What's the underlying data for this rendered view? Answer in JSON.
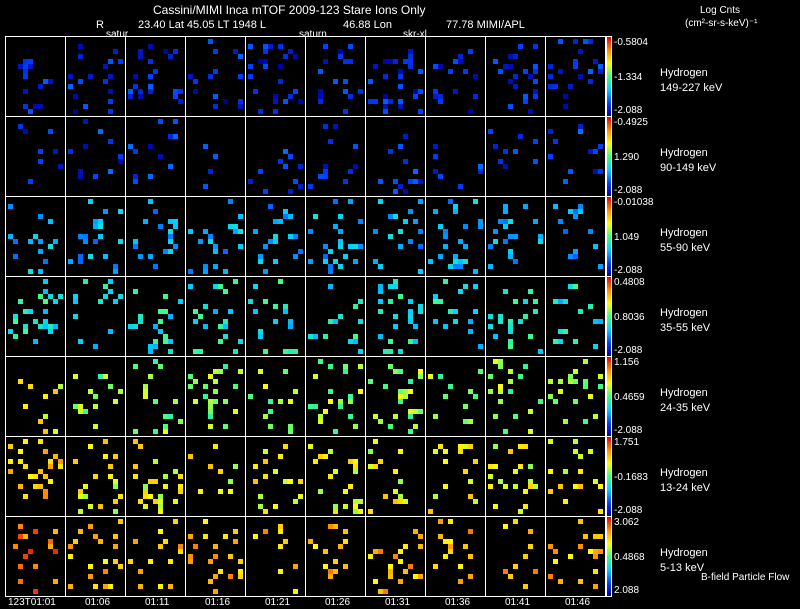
{
  "header": {
    "title": "Cassini/MIMI Inca mTOF  2009-123   Stare   Ions Only",
    "r_label": "R",
    "lat_lt": "23.40 Lat 45.05 LT 1948 L",
    "lon": "46.88 Lon",
    "lon_val": "77.78  MIMI/APL",
    "markers": [
      "satur",
      "saturn",
      "skr-xl"
    ],
    "units_title": "Log Cnts",
    "units": "(cm²-sr-s-keV)⁻¹"
  },
  "footer": {
    "flow_label": "B-field Particle Flow"
  },
  "chart_data": {
    "type": "heatmap",
    "title": "Cassini/MIMI Inca mTOF  2009-123   Stare   Ions Only",
    "x_tick_labels": [
      "123T01:01",
      "01:06",
      "01:11",
      "01:16",
      "01:21",
      "01:26",
      "01:31",
      "01:36",
      "01:41",
      "01:46"
    ],
    "rows": [
      {
        "species": "Hydrogen",
        "energy": "149-227 keV",
        "cb_max": "-0.5804",
        "cb_mid": "-1.334",
        "cb_min": "-2.088",
        "level": 0.1,
        "density": 0.12
      },
      {
        "species": "Hydrogen",
        "energy": "90-149 keV",
        "cb_max": "-0.4925",
        "cb_mid": "1.290",
        "cb_min": "-2.088",
        "level": 0.12,
        "density": 0.07
      },
      {
        "species": "Hydrogen",
        "energy": "55-90 keV",
        "cb_max": "-0.01038",
        "cb_mid": "1.049",
        "cb_min": "-2.088",
        "level": 0.3,
        "density": 0.1
      },
      {
        "species": "Hydrogen",
        "energy": "35-55 keV",
        "cb_max": "0.4808",
        "cb_mid": "0.8036",
        "cb_min": "-2.088",
        "level": 0.4,
        "density": 0.11
      },
      {
        "species": "Hydrogen",
        "energy": "24-35 keV",
        "cb_max": "1.156",
        "cb_mid": "0.4659",
        "cb_min": "-2.088",
        "level": 0.55,
        "density": 0.11
      },
      {
        "species": "Hydrogen",
        "energy": "13-24 keV",
        "cb_max": "1.751",
        "cb_mid": "-0.1683",
        "cb_min": "-2.088",
        "level": 0.65,
        "density": 0.12
      },
      {
        "species": "Hydrogen",
        "energy": "5-13 keV",
        "cb_max": "3.062",
        "cb_mid": "0.4868",
        "cb_min": "2.088",
        "level": 0.75,
        "density": 0.1
      }
    ]
  }
}
